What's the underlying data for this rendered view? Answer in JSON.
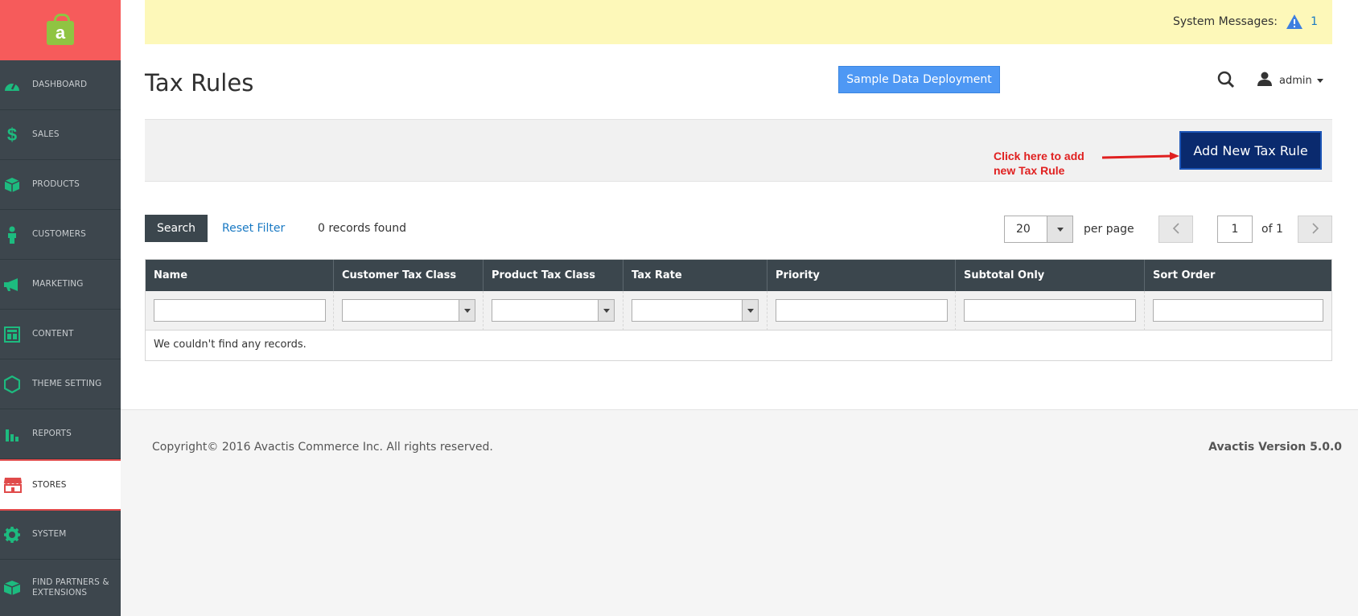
{
  "app": {
    "logo_letter": "a"
  },
  "sidebar": {
    "items": [
      {
        "label": "DASHBOARD",
        "icon": "dashboard-icon"
      },
      {
        "label": "SALES",
        "icon": "dollar-icon"
      },
      {
        "label": "PRODUCTS",
        "icon": "box-icon"
      },
      {
        "label": "CUSTOMERS",
        "icon": "person-icon"
      },
      {
        "label": "MARKETING",
        "icon": "megaphone-icon"
      },
      {
        "label": "CONTENT",
        "icon": "layout-icon"
      },
      {
        "label": "THEME SETTING",
        "icon": "hexagon-icon"
      },
      {
        "label": "REPORTS",
        "icon": "bar-chart-icon"
      },
      {
        "label": "STORES",
        "icon": "storefront-icon",
        "active": true
      },
      {
        "label": "SYSTEM",
        "icon": "gear-icon"
      },
      {
        "label": "FIND PARTNERS & EXTENSIONS",
        "icon": "cube-icon"
      }
    ],
    "icon_color": "#1dbb7f",
    "active_icon_color": "#e04a4a"
  },
  "header": {
    "system_messages_label": "System Messages:",
    "system_messages_count": "1",
    "page_title": "Tax Rules",
    "sample_data_button": "Sample Data Deployment",
    "user_name": "admin"
  },
  "action_bar": {
    "annotation": "Click here to add new Tax Rule",
    "add_button": "Add New Tax Rule"
  },
  "grid_controls": {
    "search_button": "Search",
    "reset_filter": "Reset Filter",
    "records_found": "0 records found",
    "per_page_value": "20",
    "per_page_label": "per page",
    "current_page": "1",
    "of_pages": "of 1"
  },
  "table": {
    "columns": [
      "Name",
      "Customer Tax Class",
      "Product Tax Class",
      "Tax Rate",
      "Priority",
      "Subtotal Only",
      "Sort Order"
    ],
    "empty_message": "We couldn't find any records."
  },
  "footer": {
    "copyright": "Copyright© 2016 Avactis Commerce Inc. All rights reserved.",
    "version": "Avactis Version 5.0.0"
  }
}
